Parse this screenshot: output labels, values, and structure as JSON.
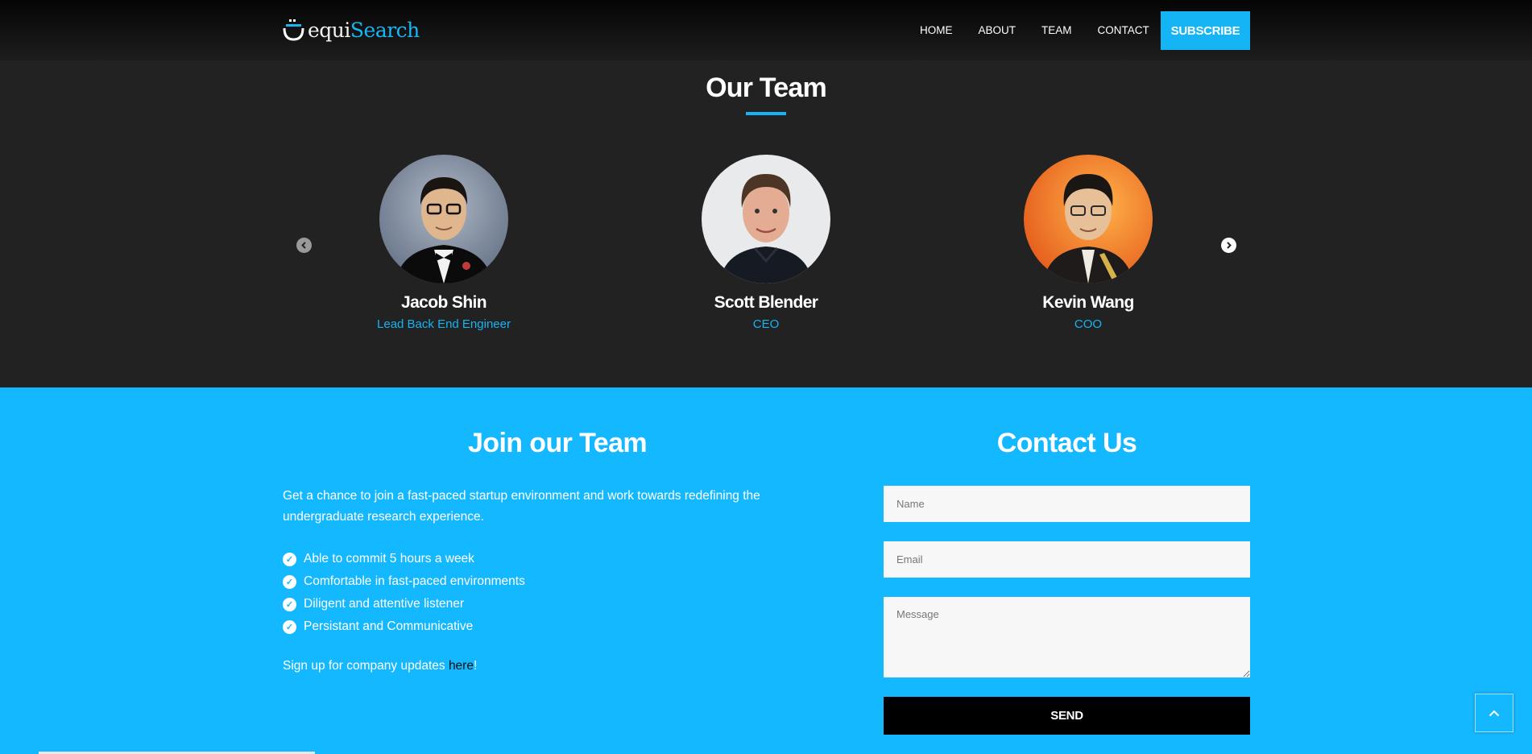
{
  "brand": {
    "logo_light": "equi",
    "logo_accent": "Search"
  },
  "nav": {
    "items": [
      "HOME",
      "ABOUT",
      "TEAM",
      "CONTACT"
    ],
    "subscribe": "SUBSCRIBE"
  },
  "team": {
    "title": "Our Team",
    "members": [
      {
        "name": "Jacob Shin",
        "role": "Lead Back End Engineer"
      },
      {
        "name": "Scott Blender",
        "role": "CEO"
      },
      {
        "name": "Kevin Wang",
        "role": "COO"
      }
    ],
    "prev_icon": "chevron-left-icon",
    "next_icon": "chevron-right-icon"
  },
  "join": {
    "title": "Join our Team",
    "description": "Get a chance to join a fast-paced startup environment and work towards redefining the undergraduate research experience.",
    "requirements": [
      "Able to commit 5 hours a week",
      "Comfortable in fast-paced environments",
      "Diligent and attentive listener",
      "Persistant and Communicative"
    ],
    "signup_prefix": "Sign up for company updates ",
    "signup_link": "here",
    "signup_suffix": "!"
  },
  "contact": {
    "title": "Contact Us",
    "name_placeholder": "Name",
    "email_placeholder": "Email",
    "message_placeholder": "Message",
    "send_label": "SEND"
  },
  "colors": {
    "accent": "#14b4f5",
    "dark_bg": "#222222",
    "blue_bg": "#14b8ff"
  }
}
